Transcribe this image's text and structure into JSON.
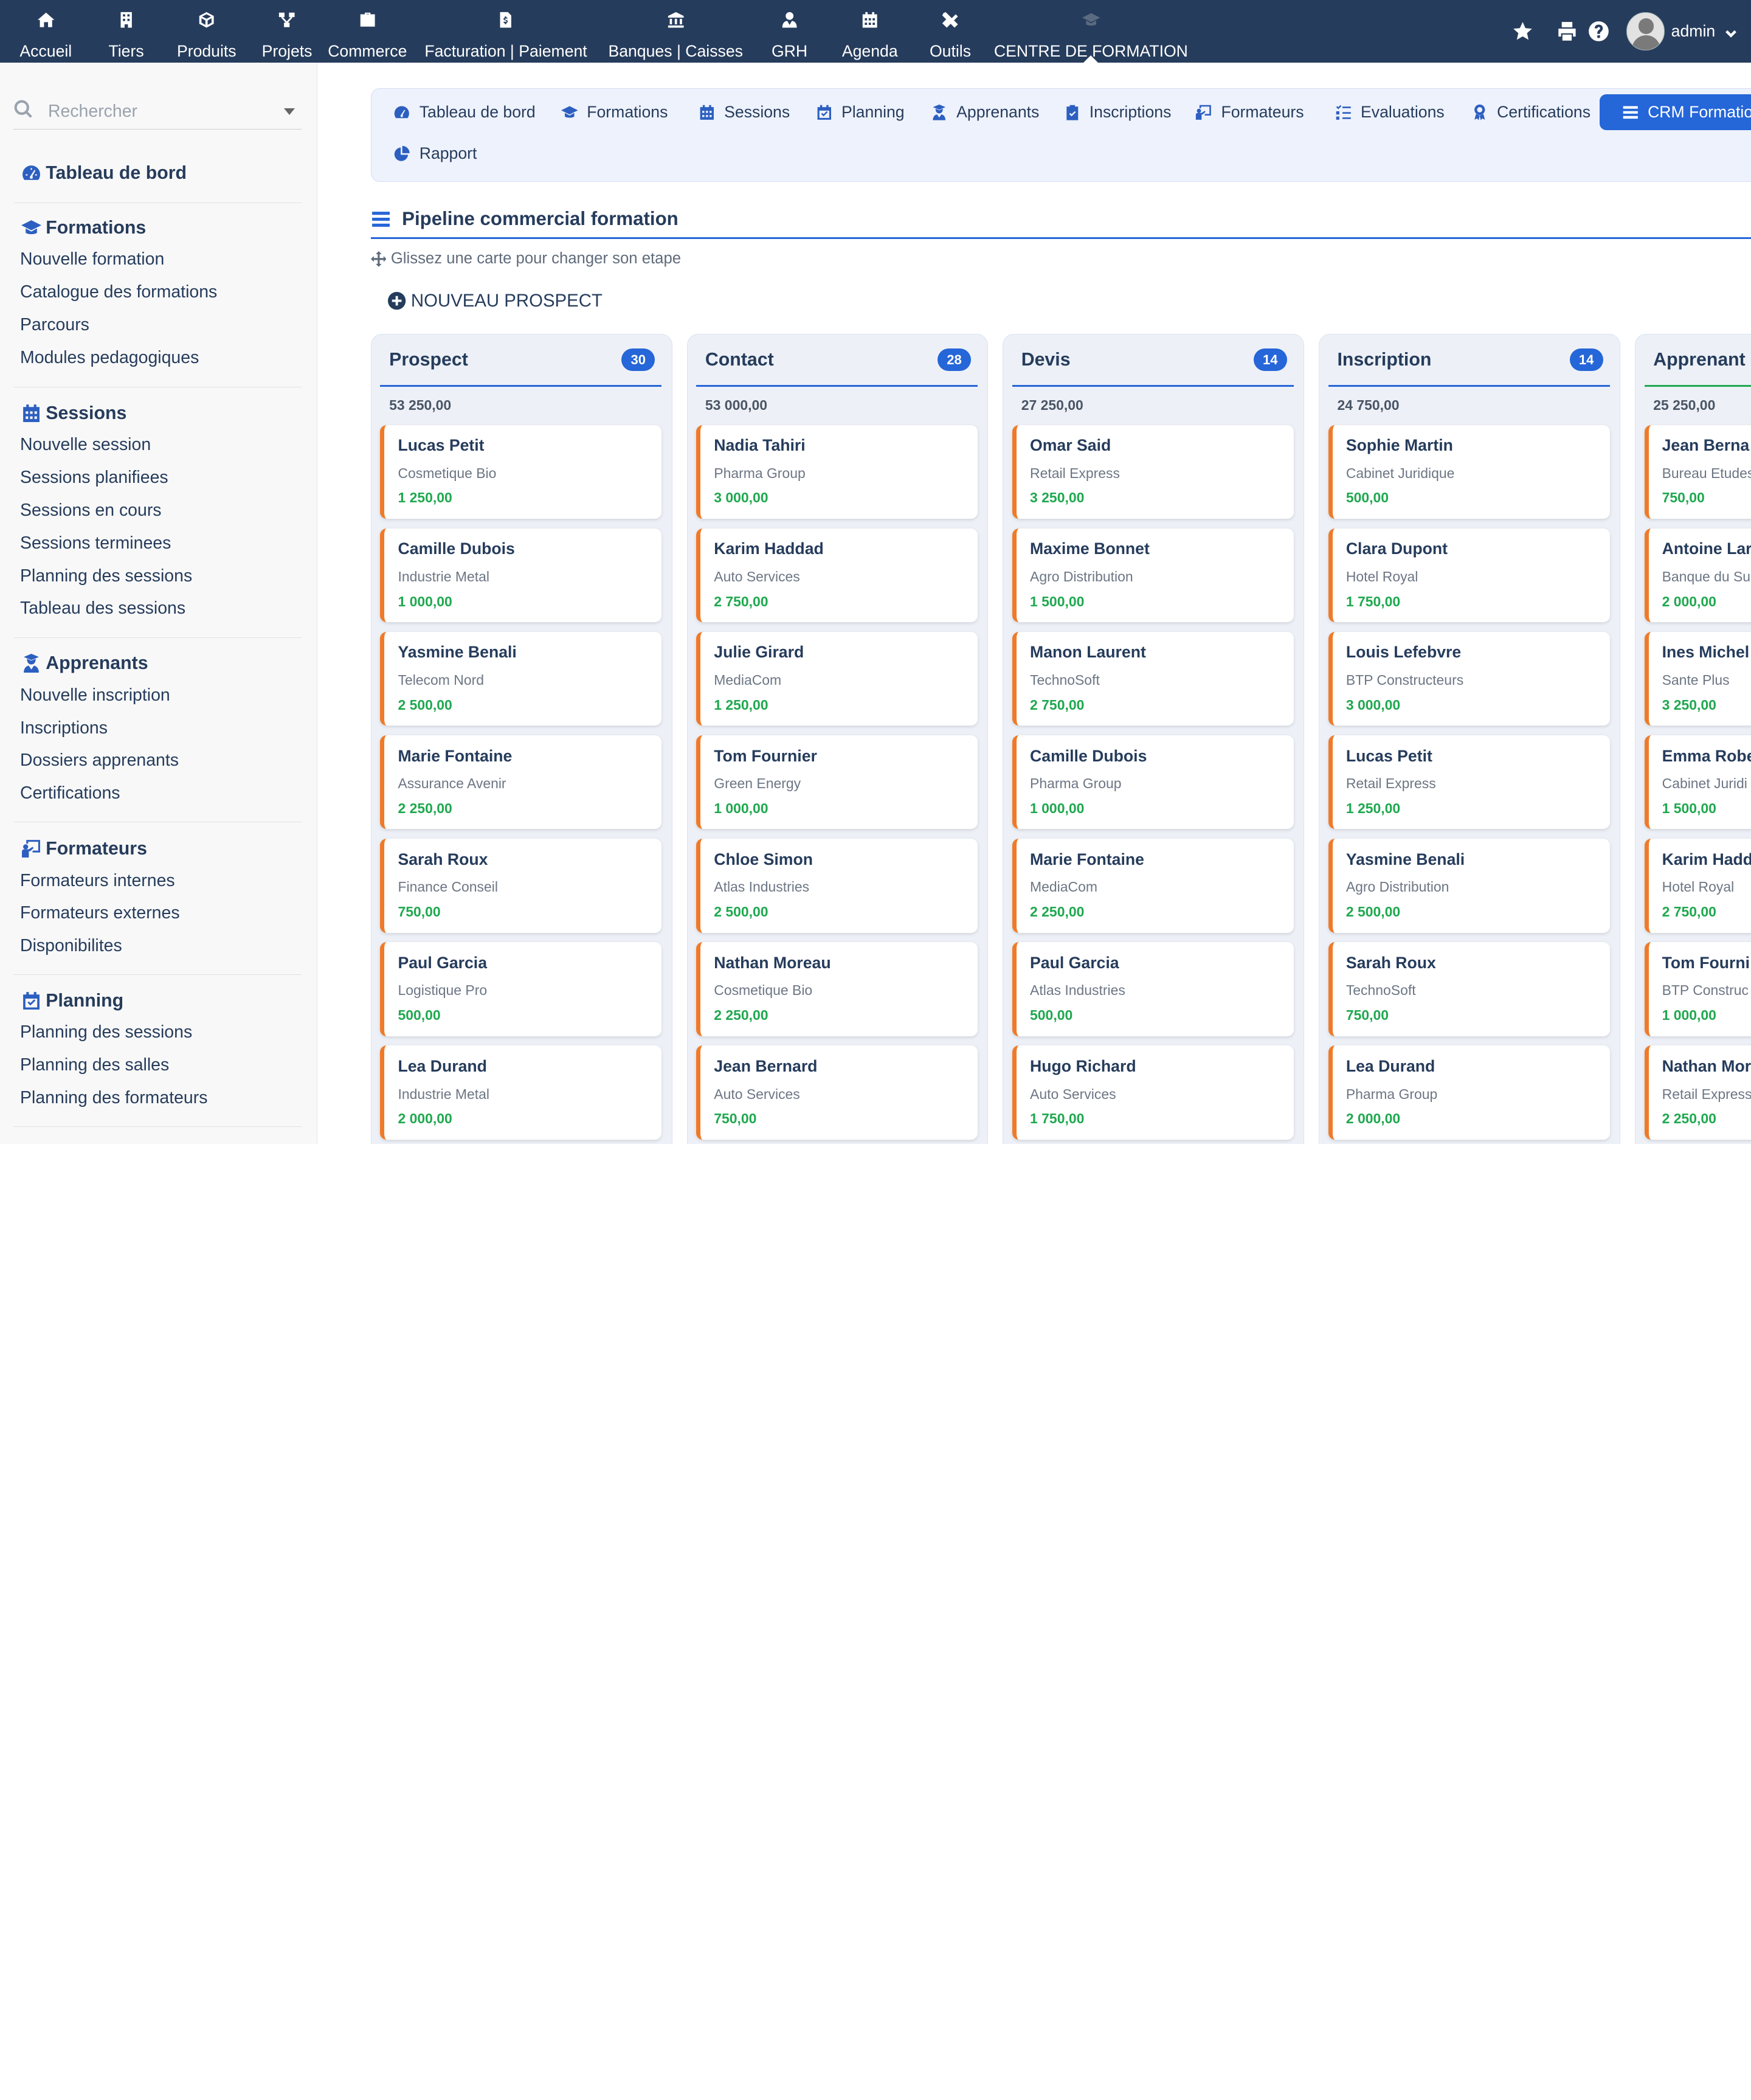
{
  "topmenu": [
    {
      "label": "Accueil",
      "icon": "home-icon"
    },
    {
      "label": "Tiers",
      "icon": "building-icon"
    },
    {
      "label": "Produits",
      "icon": "cube-icon"
    },
    {
      "label": "Projets",
      "icon": "project-icon"
    },
    {
      "label": "Commerce",
      "icon": "suitcase-icon"
    },
    {
      "label": "Facturation | Paiement",
      "icon": "invoice-icon"
    },
    {
      "label": "Banques | Caisses",
      "icon": "bank-icon"
    },
    {
      "label": "GRH",
      "icon": "user-tie-icon"
    },
    {
      "label": "Agenda",
      "icon": "calendar-icon"
    },
    {
      "label": "Outils",
      "icon": "tools-icon"
    },
    {
      "label": "CENTRE DE FORMATION",
      "icon": "graduation-cap-icon"
    }
  ],
  "topright": {
    "username": "admin"
  },
  "search": {
    "placeholder": "Rechercher"
  },
  "sidebar": {
    "dashboard": "Tableau de bord",
    "sections": [
      {
        "title": "Formations",
        "icon": "graduation-cap-icon",
        "items": [
          "Nouvelle formation",
          "Catalogue des formations",
          "Parcours",
          "Modules pedagogiques"
        ]
      },
      {
        "title": "Sessions",
        "icon": "calendar-icon",
        "items": [
          "Nouvelle session",
          "Sessions planifiees",
          "Sessions en cours",
          "Sessions terminees",
          "Planning des sessions",
          "Tableau des sessions"
        ]
      },
      {
        "title": "Apprenants",
        "icon": "learner-icon",
        "items": [
          "Nouvelle inscription",
          "Inscriptions",
          "Dossiers apprenants",
          "Certifications"
        ]
      },
      {
        "title": "Formateurs",
        "icon": "teacher-icon",
        "items": [
          "Formateurs internes",
          "Formateurs externes",
          "Disponibilites"
        ]
      },
      {
        "title": "Planning",
        "icon": "calendar-check-icon",
        "items": [
          "Planning des sessions",
          "Planning des salles",
          "Planning des formateurs"
        ]
      }
    ]
  },
  "tabs": [
    {
      "label": "Tableau de bord",
      "icon": "dashboard-icon"
    },
    {
      "label": "Formations",
      "icon": "graduation-cap-icon"
    },
    {
      "label": "Sessions",
      "icon": "calendar-icon"
    },
    {
      "label": "Planning",
      "icon": "calendar-check-icon"
    },
    {
      "label": "Apprenants",
      "icon": "learner-icon"
    },
    {
      "label": "Inscriptions",
      "icon": "clipboard-check-icon"
    },
    {
      "label": "Formateurs",
      "icon": "teacher-icon"
    },
    {
      "label": "Evaluations",
      "icon": "tasks-icon"
    },
    {
      "label": "Certifications",
      "icon": "award-icon"
    },
    {
      "label": "CRM Formation",
      "icon": "stream-icon",
      "active": true
    },
    {
      "label": "Rapport",
      "icon": "pie-chart-icon"
    }
  ],
  "page": {
    "title": "Pipeline commercial formation",
    "hint": "Glissez une carte pour changer son etape",
    "new_prospect": "NOUVEAU PROSPECT"
  },
  "colors": {
    "accent": "#2566d8",
    "topbar": "#263c5c",
    "card_border": "#f07a28",
    "amount": "#1fa84f"
  },
  "columns": [
    {
      "title": "Prospect",
      "count": "30",
      "total": "53 250,00",
      "cards": [
        {
          "name": "Lucas Petit",
          "company": "Cosmetique Bio",
          "amount": "1 250,00"
        },
        {
          "name": "Camille Dubois",
          "company": "Industrie Metal",
          "amount": "1 000,00"
        },
        {
          "name": "Yasmine Benali",
          "company": "Telecom Nord",
          "amount": "2 500,00"
        },
        {
          "name": "Marie Fontaine",
          "company": "Assurance Avenir",
          "amount": "2 250,00"
        },
        {
          "name": "Sarah Roux",
          "company": "Finance Conseil",
          "amount": "750,00"
        },
        {
          "name": "Paul Garcia",
          "company": "Logistique Pro",
          "amount": "500,00"
        },
        {
          "name": "Lea Durand",
          "company": "Industrie Metal",
          "amount": "2 000,00"
        }
      ]
    },
    {
      "title": "Contact",
      "count": "28",
      "total": "53 000,00",
      "cards": [
        {
          "name": "Nadia Tahiri",
          "company": "Pharma Group",
          "amount": "3 000,00"
        },
        {
          "name": "Karim Haddad",
          "company": "Auto Services",
          "amount": "2 750,00"
        },
        {
          "name": "Julie Girard",
          "company": "MediaCom",
          "amount": "1 250,00"
        },
        {
          "name": "Tom Fournier",
          "company": "Green Energy",
          "amount": "1 000,00"
        },
        {
          "name": "Chloe Simon",
          "company": "Atlas Industries",
          "amount": "2 500,00"
        },
        {
          "name": "Nathan Moreau",
          "company": "Cosmetique Bio",
          "amount": "2 250,00"
        },
        {
          "name": "Jean Bernard",
          "company": "Auto Services",
          "amount": "750,00"
        }
      ]
    },
    {
      "title": "Devis",
      "count": "14",
      "total": "27 250,00",
      "cards": [
        {
          "name": "Omar Said",
          "company": "Retail Express",
          "amount": "3 250,00"
        },
        {
          "name": "Maxime Bonnet",
          "company": "Agro Distribution",
          "amount": "1 500,00"
        },
        {
          "name": "Manon Laurent",
          "company": "TechnoSoft",
          "amount": "2 750,00"
        },
        {
          "name": "Camille Dubois",
          "company": "Pharma Group",
          "amount": "1 000,00"
        },
        {
          "name": "Marie Fontaine",
          "company": "MediaCom",
          "amount": "2 250,00"
        },
        {
          "name": "Paul Garcia",
          "company": "Atlas Industries",
          "amount": "500,00"
        },
        {
          "name": "Hugo Richard",
          "company": "Auto Services",
          "amount": "1 750,00"
        }
      ]
    },
    {
      "title": "Inscription",
      "count": "14",
      "total": "24 750,00",
      "cards": [
        {
          "name": "Sophie Martin",
          "company": "Cabinet Juridique",
          "amount": "500,00"
        },
        {
          "name": "Clara Dupont",
          "company": "Hotel Royal",
          "amount": "1 750,00"
        },
        {
          "name": "Louis Lefebvre",
          "company": "BTP Constructeurs",
          "amount": "3 000,00"
        },
        {
          "name": "Lucas Petit",
          "company": "Retail Express",
          "amount": "1 250,00"
        },
        {
          "name": "Yasmine Benali",
          "company": "Agro Distribution",
          "amount": "2 500,00"
        },
        {
          "name": "Sarah Roux",
          "company": "TechnoSoft",
          "amount": "750,00"
        },
        {
          "name": "Lea Durand",
          "company": "Pharma Group",
          "amount": "2 000,00"
        }
      ]
    },
    {
      "title": "Apprenant",
      "count": "",
      "total": "25 250,00",
      "cards": [
        {
          "name": "Jean Berna",
          "company": "Bureau Etudes",
          "amount": "750,00"
        },
        {
          "name": "Antoine Lar",
          "company": "Banque du Su",
          "amount": "2 000,00"
        },
        {
          "name": "Ines Michel",
          "company": "Sante Plus",
          "amount": "3 250,00"
        },
        {
          "name": "Emma Robe",
          "company": "Cabinet Juridi",
          "amount": "1 500,00"
        },
        {
          "name": "Karim Hadd",
          "company": "Hotel Royal",
          "amount": "2 750,00"
        },
        {
          "name": "Tom Fourni",
          "company": "BTP Construc",
          "amount": "1 000,00"
        },
        {
          "name": "Nathan Mor",
          "company": "Retail Express",
          "amount": "2 250,00"
        }
      ]
    }
  ]
}
